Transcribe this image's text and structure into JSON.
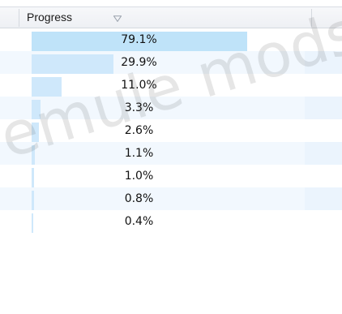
{
  "header": {
    "column_label": "Progress",
    "sort_indicator": "sort-descending-icon"
  },
  "rows": [
    {
      "label": "79.1%",
      "progress": 0.791
    },
    {
      "label": "29.9%",
      "progress": 0.299
    },
    {
      "label": "11.0%",
      "progress": 0.11
    },
    {
      "label": "3.3%",
      "progress": 0.033
    },
    {
      "label": "2.6%",
      "progress": 0.026
    },
    {
      "label": "1.1%",
      "progress": 0.011
    },
    {
      "label": "1.0%",
      "progress": 0.01
    },
    {
      "label": "0.8%",
      "progress": 0.008
    },
    {
      "label": "0.4%",
      "progress": 0.004
    }
  ],
  "watermark": "emule mods",
  "colors": {
    "bar_fill": "#cfe8fb",
    "row_alt": "#f2f8fe",
    "header_bg": "#eef0f4"
  }
}
